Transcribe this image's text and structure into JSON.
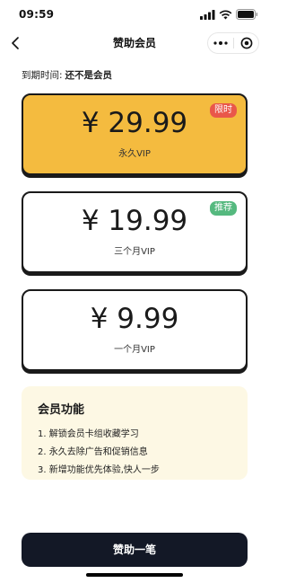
{
  "status_bar": {
    "time": "09:59",
    "icons": [
      "signal-icon",
      "wifi-icon",
      "battery-icon"
    ]
  },
  "nav": {
    "title": "赞助会员",
    "icons": [
      "back-chevron-icon",
      "more-dots-icon",
      "close-target-icon"
    ]
  },
  "expiry": {
    "label": "到期时间:",
    "value": "还不是会员"
  },
  "plans": [
    {
      "price": "¥ 29.99",
      "name": "永久VIP",
      "badge": "限时",
      "badge_color": "#e9574a",
      "background": "#f4bb3f",
      "selected": true
    },
    {
      "price": "¥ 19.99",
      "name": "三个月VIP",
      "badge": "推荐",
      "badge_color": "#55b97f",
      "background": "#ffffff",
      "selected": false
    },
    {
      "price": "¥ 9.99",
      "name": "一个月VIP",
      "badge": "",
      "badge_color": "",
      "background": "#ffffff",
      "selected": false
    }
  ],
  "features": {
    "title": "会员功能",
    "items": [
      "1. 解锁会员卡组收藏学习",
      "2. 永久去除广告和促销信息",
      "3. 新增功能优先体验,快人一步"
    ]
  },
  "cta": {
    "label": "赞助一笔"
  },
  "colors": {
    "accent": "#f4bb3f",
    "border": "#1a1a1a",
    "button": "#131826",
    "features_bg": "#fdf8e4"
  }
}
